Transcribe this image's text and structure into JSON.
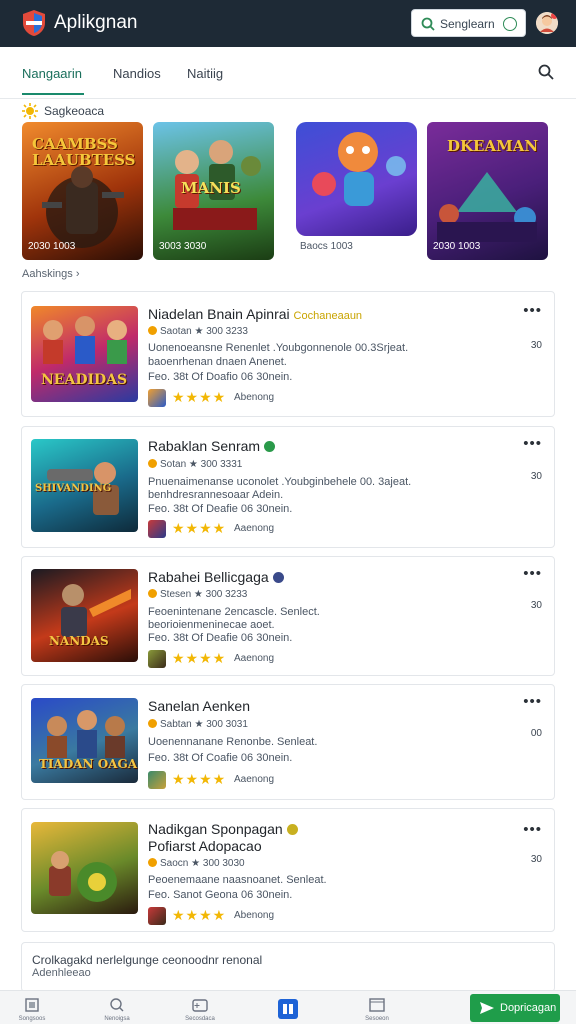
{
  "header": {
    "app_title": "Aplikgnan",
    "search_placeholder": "Senglearn"
  },
  "tabs": [
    {
      "label": "Nangaarin",
      "active": true
    },
    {
      "label": "Nandios",
      "active": false
    },
    {
      "label": "Naitiig",
      "active": false
    }
  ],
  "featured": {
    "section_label": "Sagkeoaca",
    "items": [
      {
        "title": "CAAMBSS\nLAAUBTESS",
        "price": "2030 1003"
      },
      {
        "title": "MANIS",
        "price": "3003 3030"
      },
      {
        "title": "",
        "price": "Baocs 1003"
      },
      {
        "title": "DKEAMAN",
        "price": "2030 1003"
      }
    ]
  },
  "ratings_label": "Aahskings",
  "cards": [
    {
      "title": "Niadelan Bnain Apinrai",
      "badge": "Cochaneaaun",
      "meta": "Saotan  ★ 300 3233",
      "desc1": "Uonenoeansne Renenlet .Youbgonnenole 00.3Srjeat.",
      "desc2": "baoenrhenan dnaen Anenet.",
      "desc3": "Feo. 38t Of Doafio 06 30nein.",
      "rating_label": "Abenong",
      "num": "30",
      "thumb_text": "NEADIDAS"
    },
    {
      "title": "Rabaklan Senram",
      "badge": "",
      "meta": "Sotan  ★ 300 3331",
      "desc1": "Pnuenaimenanse uconolet .Youbginbehele 00. 3ajeat.",
      "desc2": "benhdresrannesoaar Adein.",
      "desc3": "Feo. 38t Of Deafie 06 30nein.",
      "rating_label": "Aaenong",
      "num": "30",
      "thumb_text": "SHIVANDING"
    },
    {
      "title": "Rabahei Bellicgaga",
      "badge": "",
      "meta": "Stesen  ★ 300 3233",
      "desc1": "Feoenintenane 2encascle. Senlect.",
      "desc2": "beorioienmeninecae aoet.",
      "desc3": "Feo. 38t Of Deafie 06 30nein.",
      "rating_label": "Aaenong",
      "num": "30",
      "thumb_text": "NANDAS"
    },
    {
      "title": "Sanelan Aenken",
      "badge": "",
      "meta": "Sabtan  ★ 300 3031",
      "desc1": "Uoenennanane Renonbe. Senleat.",
      "desc2": "",
      "desc3": "Feo. 38t Of Coafie 06 30nein.",
      "rating_label": "Aaenong",
      "num": "00",
      "thumb_text": "TIADAN OAGA"
    },
    {
      "title": "Nadikgan Sponpagan",
      "title2": "Pofiarst Adopacao",
      "badge": "",
      "meta": "Saocn  ★ 300 3030",
      "desc1": "Peoenemaane naasnoanet. Senleat.",
      "desc2": "",
      "desc3": "Feo. Sanot Geona 06 30nein.",
      "rating_label": "Abenong",
      "num": "30",
      "thumb_text": ""
    }
  ],
  "info": {
    "line1": "Crolkagakd nerlelgunge ceonoodnr renonal",
    "line2": "Adenhleeao"
  },
  "bottom_nav": [
    {
      "label": "Songsoos"
    },
    {
      "label": "Nenoigsa"
    },
    {
      "label": "Secosdaca"
    },
    {
      "label": ""
    },
    {
      "label": "Sesoeon"
    }
  ],
  "cta_label": "Dopricagan",
  "colors": {
    "topbar": "#1e2a36",
    "accent": "#1a8a6c",
    "star": "#f2b705",
    "cta": "#1f9d4a",
    "nav_active": "#1e63d6"
  }
}
